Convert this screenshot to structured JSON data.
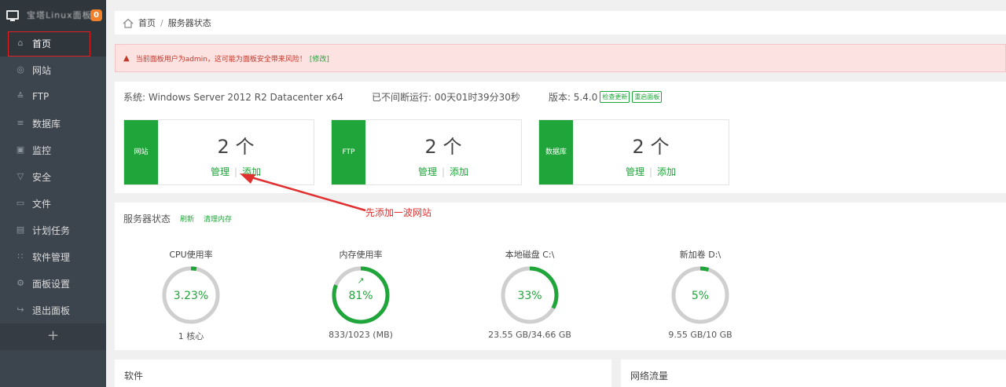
{
  "brand": {
    "name": "宝塔Linux面板",
    "badge": "0"
  },
  "sidebar": {
    "items": [
      {
        "label": "首页",
        "icon": "home-icon",
        "glyph": "⌂"
      },
      {
        "label": "网站",
        "icon": "globe-icon",
        "glyph": "◎"
      },
      {
        "label": "FTP",
        "icon": "ftp-icon",
        "glyph": "≙"
      },
      {
        "label": "数据库",
        "icon": "database-icon",
        "glyph": "≡"
      },
      {
        "label": "监控",
        "icon": "monitor-icon",
        "glyph": "▣"
      },
      {
        "label": "安全",
        "icon": "shield-icon",
        "glyph": "▽"
      },
      {
        "label": "文件",
        "icon": "folder-icon",
        "glyph": "▭"
      },
      {
        "label": "计划任务",
        "icon": "calendar-icon",
        "glyph": "▤"
      },
      {
        "label": "软件管理",
        "icon": "apps-icon",
        "glyph": "∷"
      },
      {
        "label": "面板设置",
        "icon": "gear-icon",
        "glyph": "⚙"
      },
      {
        "label": "退出面板",
        "icon": "logout-icon",
        "glyph": "↪"
      }
    ],
    "add": "+"
  },
  "breadcrumb": {
    "home": "首页",
    "sep": "/",
    "current": "服务器状态"
  },
  "alert": {
    "text": "当前面板用户为admin，这可能为面板安全带来风险！",
    "link": "[修改]"
  },
  "system": {
    "os": "系统: Windows Server 2012 R2 Datacenter x64",
    "uptime": "已不间断运行: 00天01时39分30秒",
    "version": "版本: 5.4.0",
    "check_update": "检查更新",
    "restart": "重启面板"
  },
  "cards": [
    {
      "tag": "网站",
      "count": "2 个",
      "manage": "管理",
      "add": "添加"
    },
    {
      "tag": "FTP",
      "count": "2 个",
      "manage": "管理",
      "add": "添加"
    },
    {
      "tag": "数据库",
      "count": "2 个",
      "manage": "管理",
      "add": "添加"
    }
  ],
  "annotation": "先添加一波网站",
  "status": {
    "title": "服务器状态",
    "refresh": "刷新",
    "clean": "清理内存",
    "gauges": [
      {
        "title": "CPU使用率",
        "value": "3.23%",
        "percent": 3.23,
        "bottom": "1 核心"
      },
      {
        "title": "内存使用率",
        "value": "81%",
        "percent": 81,
        "bottom": "833/1023 (MB)"
      },
      {
        "title": "本地磁盘 C:\\",
        "value": "33%",
        "percent": 33,
        "bottom": "23.55 GB/34.66 GB"
      },
      {
        "title": "新加卷 D:\\",
        "value": "5%",
        "percent": 5,
        "bottom": "9.55 GB/10 GB"
      }
    ]
  },
  "software": {
    "title": "软件"
  },
  "network": {
    "title": "网络流量"
  },
  "colors": {
    "accent": "#20a53a",
    "sidebar": "#3c444d",
    "alert_bg": "#fde2e2",
    "annotation": "#e03030"
  }
}
